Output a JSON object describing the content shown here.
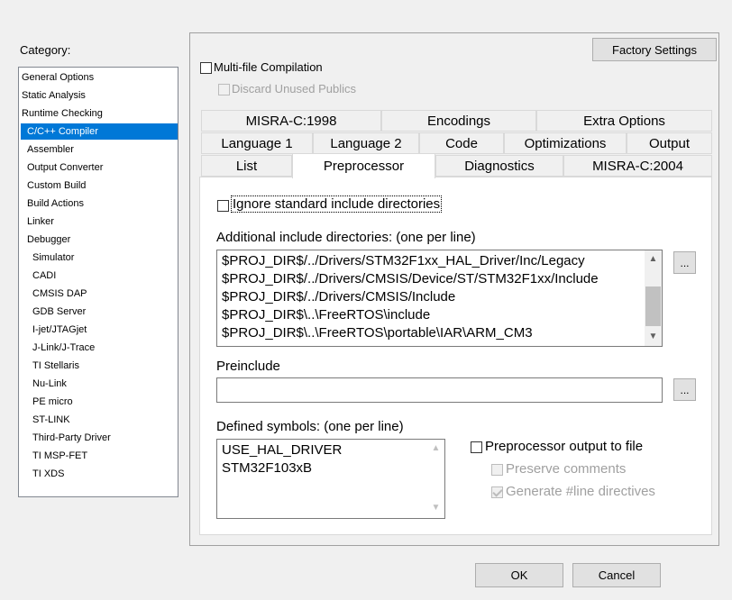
{
  "category": {
    "label": "Category:",
    "items": [
      {
        "label": "General Options",
        "indent": 0
      },
      {
        "label": "Static Analysis",
        "indent": 0
      },
      {
        "label": "Runtime Checking",
        "indent": 0
      },
      {
        "label": "C/C++ Compiler",
        "indent": 1,
        "selected": true
      },
      {
        "label": "Assembler",
        "indent": 1
      },
      {
        "label": "Output Converter",
        "indent": 1
      },
      {
        "label": "Custom Build",
        "indent": 1
      },
      {
        "label": "Build Actions",
        "indent": 1
      },
      {
        "label": "Linker",
        "indent": 1
      },
      {
        "label": "Debugger",
        "indent": 1
      },
      {
        "label": "Simulator",
        "indent": 2
      },
      {
        "label": "CADI",
        "indent": 2
      },
      {
        "label": "CMSIS DAP",
        "indent": 2
      },
      {
        "label": "GDB Server",
        "indent": 2
      },
      {
        "label": "I-jet/JTAGjet",
        "indent": 2
      },
      {
        "label": "J-Link/J-Trace",
        "indent": 2
      },
      {
        "label": "TI Stellaris",
        "indent": 2
      },
      {
        "label": "Nu-Link",
        "indent": 2
      },
      {
        "label": "PE micro",
        "indent": 2
      },
      {
        "label": "ST-LINK",
        "indent": 2
      },
      {
        "label": "Third-Party Driver",
        "indent": 2
      },
      {
        "label": "TI MSP-FET",
        "indent": 2
      },
      {
        "label": "TI XDS",
        "indent": 2
      }
    ]
  },
  "factory_settings": "Factory Settings",
  "multi_file": "Multi-file Compilation",
  "discard_unused": "Discard Unused Publics",
  "tabs_row1": [
    "MISRA-C:1998",
    "Encodings",
    "Extra Options"
  ],
  "tabs_row2": [
    "Language 1",
    "Language 2",
    "Code",
    "Optimizations",
    "Output"
  ],
  "tabs_row3": [
    "List",
    "Preprocessor",
    "Diagnostics",
    "MISRA-C:2004"
  ],
  "preprocessor": {
    "ignore_std": "Ignore standard include directories",
    "include_label": "Additional include directories: (one per line)",
    "include_dirs": [
      "$PROJ_DIR$/../Drivers/STM32F1xx_HAL_Driver/Inc/Legacy",
      "$PROJ_DIR$/../Drivers/CMSIS/Device/ST/STM32F1xx/Include",
      "$PROJ_DIR$/../Drivers/CMSIS/Include",
      "$PROJ_DIR$\\..\\FreeRTOS\\include",
      "$PROJ_DIR$\\..\\FreeRTOS\\portable\\IAR\\ARM_CM3"
    ],
    "browse": "...",
    "preinclude_label": "Preinclude",
    "preinclude_value": "",
    "defined_label": "Defined symbols: (one per line)",
    "defined_symbols": [
      "USE_HAL_DRIVER",
      "STM32F103xB"
    ],
    "pp_output": "Preprocessor output to file",
    "preserve_comments": "Preserve comments",
    "generate_line": "Generate #line directives"
  },
  "ok": "OK",
  "cancel": "Cancel"
}
